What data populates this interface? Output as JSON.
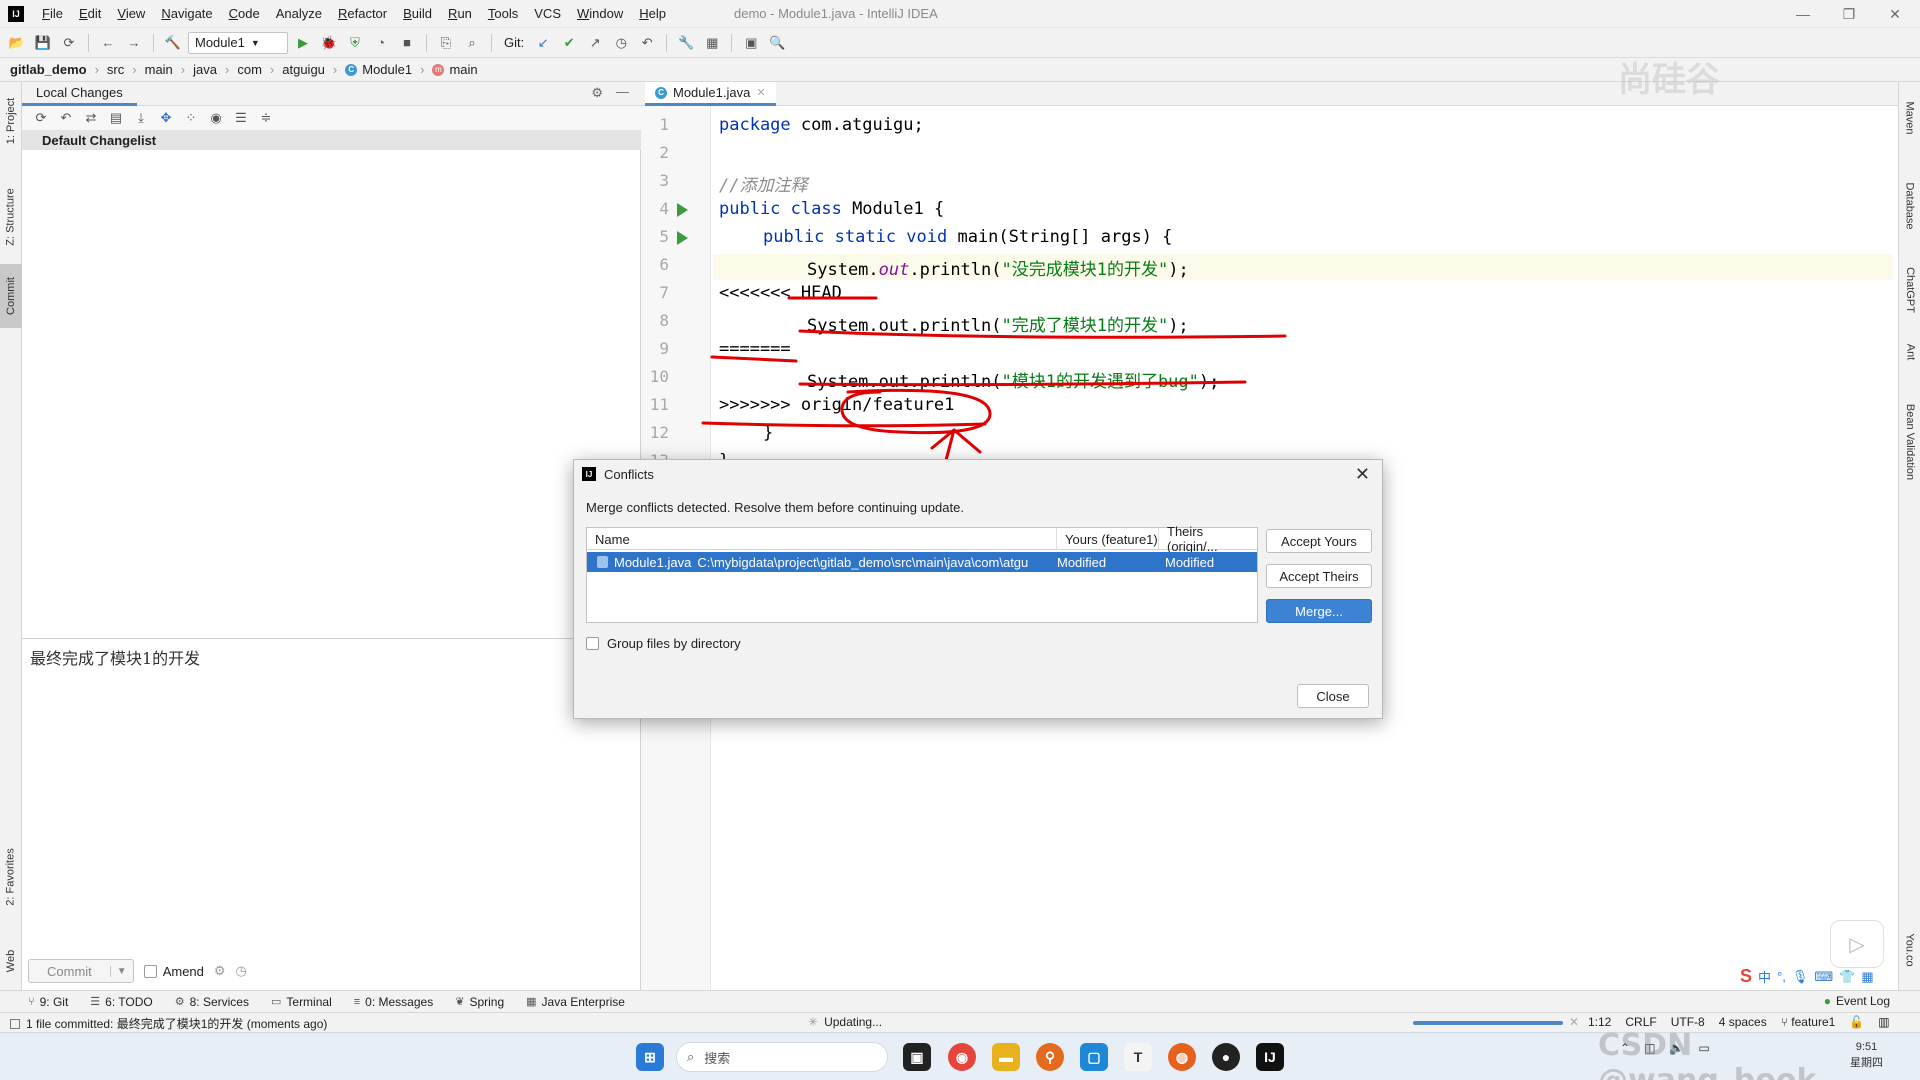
{
  "window": {
    "logo": "IJ",
    "title": "demo - Module1.java - IntelliJ IDEA",
    "menu": [
      {
        "label": "File",
        "mn": "F",
        "rest": "ile"
      },
      {
        "label": "Edit",
        "mn": "E",
        "rest": "dit"
      },
      {
        "label": "View",
        "mn": "V",
        "rest": "iew"
      },
      {
        "label": "Navigate",
        "mn": "N",
        "rest": "avigate"
      },
      {
        "label": "Code",
        "mn": "C",
        "rest": "ode"
      },
      {
        "label": "Analyze",
        "mn": "",
        "rest": "Analyze"
      },
      {
        "label": "Refactor",
        "mn": "R",
        "rest": "efactor"
      },
      {
        "label": "Build",
        "mn": "B",
        "rest": "uild"
      },
      {
        "label": "Run",
        "mn": "R",
        "rest": "un"
      },
      {
        "label": "Tools",
        "mn": "T",
        "rest": "ools"
      },
      {
        "label": "VCS",
        "mn": "",
        "rest": "VCS"
      },
      {
        "label": "Window",
        "mn": "W",
        "rest": "indow"
      },
      {
        "label": "Help",
        "mn": "H",
        "rest": "elp"
      }
    ]
  },
  "toolbar": {
    "run_config": "Module1",
    "git_label": "Git:"
  },
  "breadcrumb": [
    "gitlab_demo",
    "src",
    "main",
    "java",
    "com",
    "atguigu",
    "Module1",
    "main"
  ],
  "left_tabs": [
    "1: Project",
    "Z: Structure",
    "Commit",
    "2: Favorites",
    "Web"
  ],
  "right_tabs": [
    "Maven",
    "Database",
    "ChatGPT",
    "Ant",
    "Bean Validation",
    "You.co"
  ],
  "commit_panel": {
    "tab": "Local Changes",
    "changelist": "Default Changelist",
    "message": "最终完成了模块1的开发",
    "commit_label": "Commit",
    "amend_label": "Amend"
  },
  "editor": {
    "tab": "Module1.java",
    "line_numbers": [
      "1",
      "2",
      "3",
      "4",
      "5",
      "6",
      "7",
      "8",
      "9",
      "10",
      "11",
      "12",
      "13"
    ],
    "lines": {
      "l1_kw": "package",
      "l1_rest": " com.atguigu;",
      "l3": "//添加注释",
      "l4_kw": "public class",
      "l4_rest": " Module1 {",
      "l5_kw": "public static void",
      "l5_rest": " main(String[] args) {",
      "l6_a": "System.",
      "l6_out": "out",
      "l6_b": ".println(",
      "l6_str": "\"没完成模块1的开发\"",
      "l6_c": ");",
      "l7": "<<<<<<< HEAD",
      "l8_a": "System.out.println(",
      "l8_str": "\"完成了模块1的开发\"",
      "l8_c": ");",
      "l9": "=======",
      "l10_a": "System.out.println(",
      "l10_str": "\"模块1的开发遇到了bug\"",
      "l10_c": ");",
      "l11": ">>>>>>> origin/feature1",
      "l12": "}",
      "l13": "}"
    }
  },
  "dialog": {
    "title": "Conflicts",
    "message": "Merge conflicts detected. Resolve them before continuing update.",
    "columns": [
      "Name",
      "Yours (feature1)",
      "Theirs (origin/..."
    ],
    "row": {
      "file": "Module1.java",
      "path": "C:\\mybigdata\\project\\gitlab_demo\\src\\main\\java\\com\\atgu",
      "yours": "Modified",
      "theirs": "Modified"
    },
    "accept_yours": "Accept Yours",
    "accept_theirs": "Accept Theirs",
    "merge": "Merge...",
    "group_files": "Group files by directory",
    "close": "Close"
  },
  "tool_windows": [
    {
      "icon": "git-icon",
      "label": "9: Git"
    },
    {
      "icon": "todo-icon",
      "label": "6: TODO"
    },
    {
      "icon": "services-icon",
      "label": "8: Services"
    },
    {
      "icon": "terminal-icon",
      "label": "Terminal"
    },
    {
      "icon": "messages-icon",
      "label": "0: Messages"
    },
    {
      "icon": "spring-icon",
      "label": "Spring"
    },
    {
      "icon": "java-enterprise-icon",
      "label": "Java Enterprise"
    }
  ],
  "event_log": "Event Log",
  "status": {
    "message": "1 file committed: 最终完成了模块1的开发 (moments ago)",
    "updating": "Updating...",
    "position": "1:12",
    "line_sep": "CRLF",
    "encoding": "UTF-8",
    "indent": "4 spaces",
    "branch": "feature1",
    "progress": 1.0
  },
  "taskbar": {
    "search_placeholder": "搜索",
    "time": "9:51",
    "day": "星期四"
  },
  "watermarks": {
    "brand": "尚硅谷",
    "csdn": "CSDN @wang_book"
  },
  "colors": {
    "accent": "#4a88c7",
    "annotation": "#e00000",
    "selection": "#2e74c9"
  }
}
